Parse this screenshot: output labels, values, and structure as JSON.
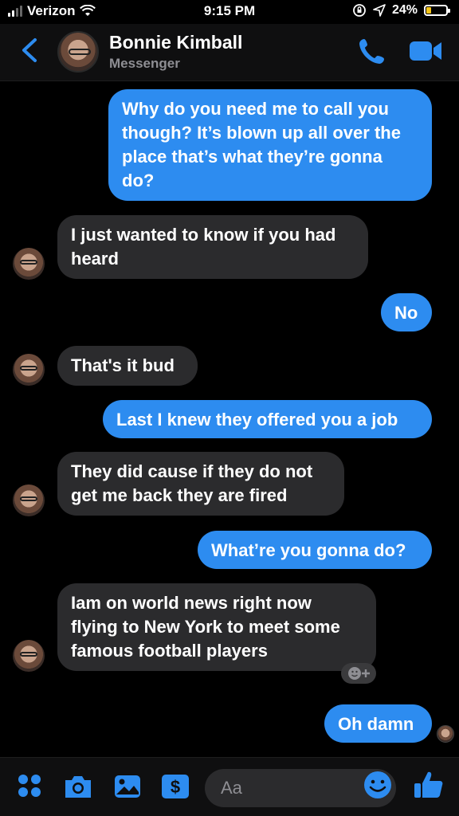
{
  "status_bar": {
    "carrier": "Verizon",
    "time": "9:15 PM",
    "battery": "24%"
  },
  "header": {
    "name": "Bonnie Kimball",
    "subtitle": "Messenger"
  },
  "messages": [
    {
      "side": "out",
      "text": "Why do you need me to call you\nthough? It’s blown up all over the\nplace that’s what they’re gonna\ndo?"
    },
    {
      "side": "in",
      "text": "I just wanted to know if you had\nheard"
    },
    {
      "side": "out",
      "text": "No"
    },
    {
      "side": "in",
      "text": "That's it bud"
    },
    {
      "side": "out",
      "text": "Last I knew they offered you a job"
    },
    {
      "side": "in",
      "text": "They did cause if they do not\nget me back they are fired"
    },
    {
      "side": "out",
      "text": "What’re you gonna do?"
    },
    {
      "side": "in",
      "text": "Iam on world news right now\nflying to New York to meet some\nfamous football players"
    },
    {
      "side": "out",
      "text": "Oh damn"
    }
  ],
  "composer": {
    "placeholder": "Aa"
  },
  "colors": {
    "accent": "#2d8cf0",
    "incoming_bubble": "#2b2b2d",
    "battery_fill": "#f5c518"
  },
  "icons": {
    "menu": "grid-dots-icon",
    "camera": "camera-icon",
    "gallery": "image-icon",
    "payment": "dollar-icon",
    "emoji": "emoji-icon",
    "like": "thumbs-up-icon"
  }
}
